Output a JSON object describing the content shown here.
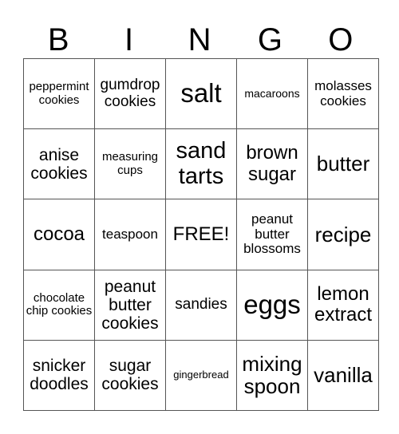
{
  "header": [
    "B",
    "I",
    "N",
    "G",
    "O"
  ],
  "cells": [
    [
      "peppermint cookies",
      "gumdrop cookies",
      "salt",
      "macaroons",
      "molasses cookies"
    ],
    [
      "anise cookies",
      "measuring cups",
      "sand tarts",
      "brown sugar",
      "butter"
    ],
    [
      "cocoa",
      "teaspoon",
      "FREE!",
      "peanut butter blossoms",
      "recipe"
    ],
    [
      "chocolate chip cookies",
      "peanut butter cookies",
      "sandies",
      "eggs",
      "lemon extract"
    ],
    [
      "snicker doodles",
      "sugar cookies",
      "gingerbread",
      "mixing spoon",
      "vanilla"
    ]
  ]
}
